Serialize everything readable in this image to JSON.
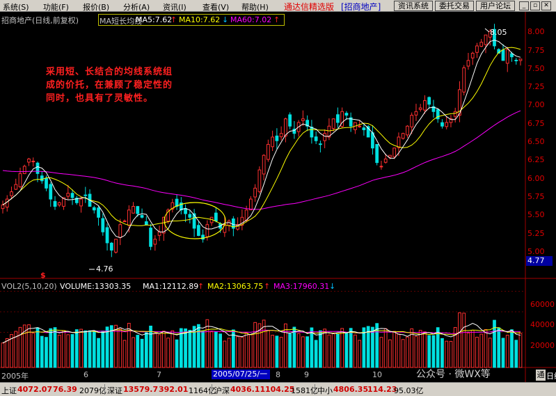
{
  "menu": {
    "items": [
      "系统(S)",
      "功能(F)",
      "报价(B)",
      "分析(A)",
      "资讯(I)",
      "查看(V)",
      "帮助(H)"
    ],
    "app_title": "通达信精选版",
    "stock_bracket": "[招商地产]",
    "buttons": [
      "资讯系统",
      "委托交易",
      "用户论坛"
    ]
  },
  "chart_header": {
    "stock": "招商地产(日线,前复权)",
    "indicator": "MA短长均线",
    "ma5": "MA5:7.62",
    "ma10": "MA10:7.62",
    "ma60": "MA60:7.02",
    "colors": {
      "ma5": "#ffffff",
      "ma10": "#ffff00",
      "ma60": "#ff00ff"
    }
  },
  "annotation": {
    "lines": [
      "采用短、长结合的均线系统组",
      "成的价托，在兼顾了稳定性的",
      "同时，也具有了灵敏性。"
    ],
    "color": "#ff2020"
  },
  "price_axis": {
    "ticks": [
      "8.00",
      "7.75",
      "7.50",
      "7.25",
      "7.00",
      "6.75",
      "6.50",
      "6.25",
      "6.00",
      "5.75",
      "5.50",
      "5.25",
      "5.00"
    ],
    "current_price_tag": "4.77",
    "high_label": "8.05",
    "low_label": "4.76"
  },
  "volume_header": {
    "name": "VOL2(5,10,20)",
    "volume": "VOLUME:13303.35",
    "ma1": "MA1:12112.89",
    "ma2": "MA2:13063.75",
    "ma3": "MA3:17960.31"
  },
  "volume_axis": {
    "ticks": [
      "60000",
      "40000",
      "20000"
    ]
  },
  "date_axis": {
    "labels": [
      "2005年",
      "6",
      "7",
      "8",
      "9",
      "10"
    ],
    "highlight": "2005/07/25/一"
  },
  "misc": {
    "dividend_mark": "$",
    "corner_button": "通",
    "line_label": "日线",
    "watermark": "公众号 · 微WX等"
  },
  "status": {
    "sh_label": "上证",
    "sh_index": "4072.07",
    "sh_change": "76.39",
    "sh_amount": "2079亿",
    "sz_label": "深证",
    "sz_index": "13579.7",
    "sz_change": "392.01",
    "sz_amount": "1164亿",
    "hs_label": "沪深",
    "hs_index": "4036.11",
    "hs_change": "104.25",
    "hs_amount": "1581亿",
    "zx_label": "中小",
    "zx_index": "4806.35",
    "zx_change": "114.23",
    "zx_amount": "95.03亿"
  },
  "chart_data": {
    "type": "candlestick",
    "closes": [
      5.62,
      5.7,
      5.8,
      5.9,
      6.05,
      6.15,
      6.25,
      6.22,
      6.05,
      5.95,
      5.85,
      5.7,
      5.6,
      5.65,
      5.72,
      5.78,
      5.72,
      5.65,
      5.7,
      5.75,
      5.6,
      5.55,
      5.45,
      5.25,
      5.1,
      5.0,
      5.15,
      5.35,
      5.4,
      5.55,
      5.6,
      5.5,
      5.45,
      5.35,
      5.05,
      5.15,
      5.25,
      5.45,
      5.55,
      5.65,
      5.6,
      5.55,
      5.5,
      5.45,
      5.3,
      5.2,
      5.15,
      5.35,
      5.45,
      5.4,
      5.3,
      5.35,
      5.4,
      5.3,
      5.35,
      5.45,
      5.55,
      5.7,
      5.85,
      6.1,
      6.3,
      6.45,
      6.55,
      6.5,
      6.6,
      6.8,
      6.7,
      6.6,
      6.75,
      6.8,
      6.7,
      6.55,
      6.5,
      6.45,
      6.6,
      6.7,
      6.8,
      6.75,
      6.9,
      6.85,
      6.7,
      6.75,
      6.7,
      6.65,
      6.55,
      6.4,
      6.2,
      6.15,
      6.25,
      6.3,
      6.4,
      6.55,
      6.6,
      6.7,
      6.85,
      6.9,
      6.95,
      7.05,
      7.0,
      6.9,
      6.8,
      6.7,
      6.75,
      6.8,
      6.9,
      7.2,
      7.5,
      7.6,
      7.7,
      7.8,
      7.85,
      7.95,
      8.0,
      7.8,
      7.7,
      7.6,
      7.75,
      7.65,
      7.6,
      7.62
    ],
    "ma5_last": 7.62,
    "ma10_last": 7.62,
    "ma60_last": 7.02,
    "price_range": [
      4.76,
      8.05
    ],
    "volume_ticks": [
      20000,
      40000,
      60000
    ],
    "volume_last": 13303.35
  }
}
